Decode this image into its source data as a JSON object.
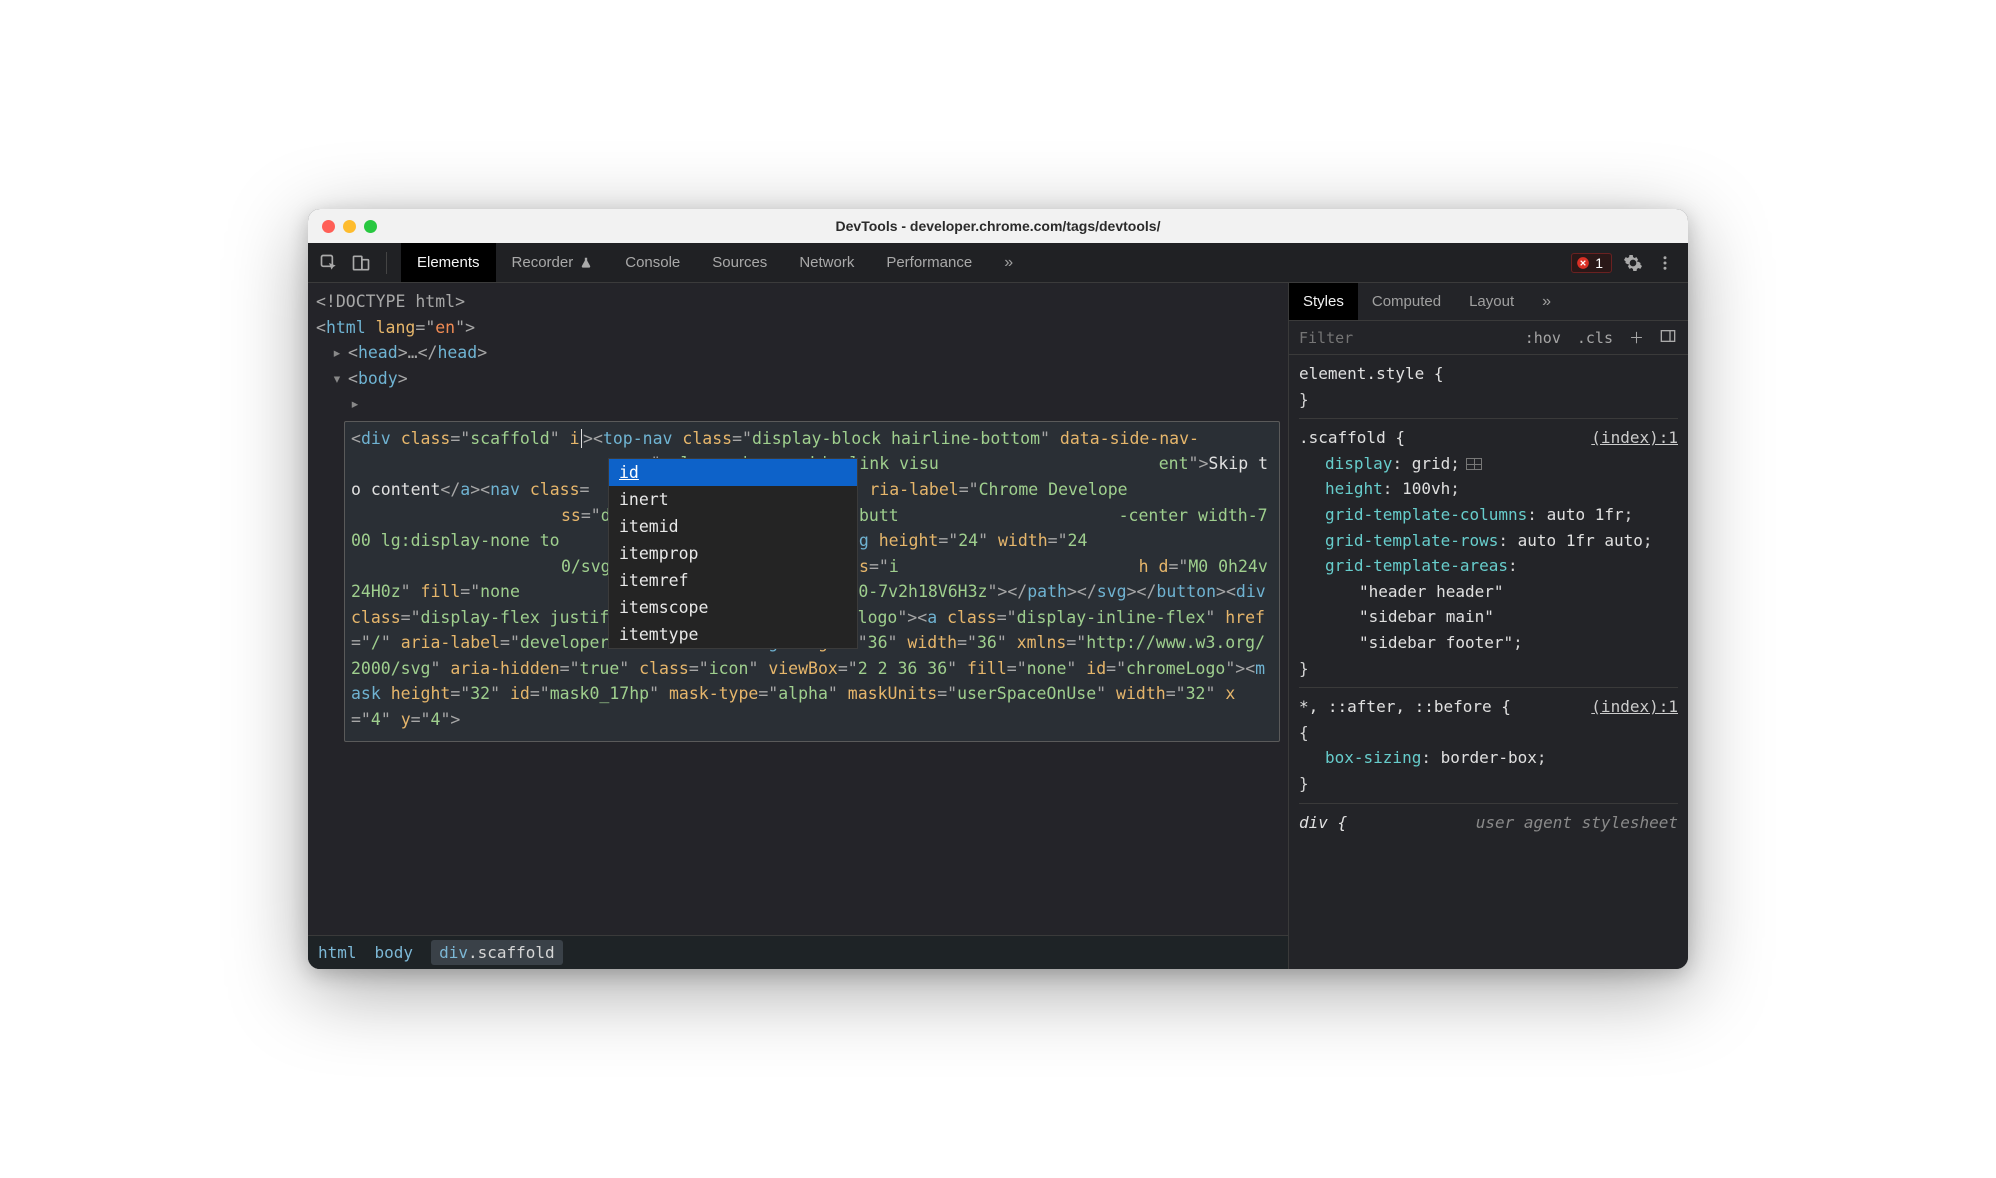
{
  "window": {
    "title": "DevTools - developer.chrome.com/tags/devtools/"
  },
  "toolbar": {
    "tabs": [
      "Elements",
      "Recorder",
      "Console",
      "Sources",
      "Network",
      "Performance"
    ],
    "active_tab": "Elements",
    "error_count": "1"
  },
  "dom": {
    "doctype": "<!DOCTYPE html>",
    "html_open": {
      "tag": "html",
      "attr": "lang",
      "val": "en"
    },
    "head": "head",
    "body": "body",
    "editing_attr_prefix": "i",
    "selected_html": "<div class=\"scaffold\" i><top-nav class=\"display-block hairline-bottom\" data-side-nav-… ss=\"color-primary skip-link visu ent\">Skip to content</a><nav class= ria-label=\"Chrome Develope ss=\"display-flex align-center butt -center width-700 lg:display-none to \"menu\"><svg height=\"24\" width=\"24 0/svg\" aria-hidden=\"true\" class=\"i h d=\"M0 0h24v24H0z\" fill=\"none …H3v2zm0-5h18v-2H3v2zm0-7v2h18V6H3z\"></path></svg></button><div class=\"display-flex justify-content-start top-nav__logo\"><a class=\"display-inline-flex\" href=\"/\" aria-label=\"developer.chrome.com\"><svg height=\"36\" width=\"36\" xmlns=\"http://www.w3.org/2000/svg\" aria-hidden=\"true\" class=\"icon\" viewBox=\"2 2 36 36\" fill=\"none\" id=\"chromeLogo\"><mask height=\"32\" id=\"mask0_17hp\" mask-type=\"alpha\" maskUnits=\"userSpaceOnUse\" width=\"32\" x=\"4\" y=\"4\">"
  },
  "autocomplete": {
    "items": [
      "id",
      "inert",
      "itemid",
      "itemprop",
      "itemref",
      "itemscope",
      "itemtype"
    ],
    "selected": "id"
  },
  "breadcrumbs": {
    "items": [
      "html",
      "body"
    ],
    "active": {
      "tag": "div",
      "cls": ".scaffold"
    }
  },
  "styles": {
    "tabs": [
      "Styles",
      "Computed",
      "Layout"
    ],
    "active_tab": "Styles",
    "filter_placeholder": "Filter",
    "hov": ":hov",
    "cls": ".cls",
    "element_style": "element.style {",
    "scaffold_sel": ".scaffold {",
    "scaffold_src": "(index):1",
    "rules_scaffold": [
      {
        "p": "display",
        "v": "grid",
        "swatch": true
      },
      {
        "p": "height",
        "v": "100vh"
      },
      {
        "p": "grid-template-columns",
        "v": "auto 1fr"
      },
      {
        "p": "grid-template-rows",
        "v": "auto 1fr auto"
      },
      {
        "p": "grid-template-areas",
        "v": "\"header header\" \"sidebar main\" \"sidebar footer\""
      }
    ],
    "star_sel": "*, ::after, ::before {",
    "star_src": "(index):1",
    "rules_star": [
      {
        "p": "box-sizing",
        "v": "border-box"
      }
    ],
    "ua_sel": "div {",
    "ua_src": "user agent stylesheet"
  }
}
